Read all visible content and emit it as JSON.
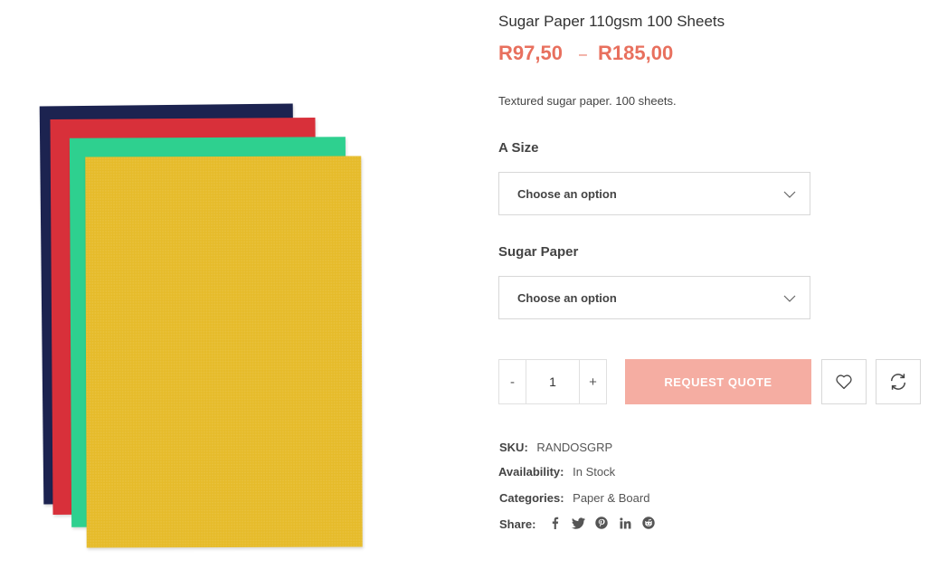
{
  "product": {
    "title": "Sugar Paper 110gsm 100 Sheets",
    "price_min": "R97,50",
    "price_separator": "–",
    "price_max": "R185,00",
    "description": "Textured sugar paper. 100 sheets."
  },
  "attributes": [
    {
      "label": "A Size",
      "selected": "Choose an option"
    },
    {
      "label": "Sugar Paper",
      "selected": "Choose an option"
    }
  ],
  "cart": {
    "minus": "-",
    "quantity": "1",
    "plus": "+",
    "request_quote": "REQUEST QUOTE"
  },
  "meta": {
    "sku_label": "SKU:",
    "sku_value": "RANDOSGRP",
    "availability_label": "Availability:",
    "availability_value": "In Stock",
    "categories_label": "Categories:",
    "categories_value": "Paper & Board",
    "share_label": "Share:"
  },
  "share_icons": [
    "facebook-icon",
    "twitter-icon",
    "pinterest-icon",
    "linkedin-icon",
    "reddit-icon"
  ],
  "colors": {
    "price": "#e8705e",
    "quote_button": "#f5ada2",
    "sheet_navy": "#1c2350",
    "sheet_red": "#d8303a",
    "sheet_green": "#2ed08f",
    "sheet_yellow": "#e6bb2a"
  }
}
